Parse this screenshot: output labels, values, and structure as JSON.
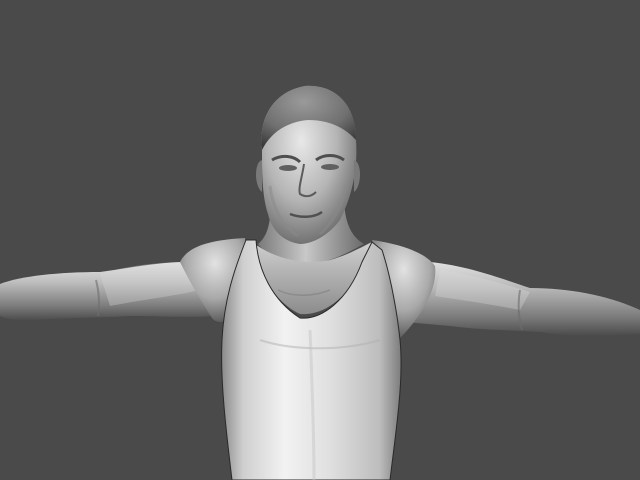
{
  "viewport": {
    "background_color": "#4a4a4a",
    "shading": "grey-clay-matcap",
    "subject": "t-pose-male-character-sculpt",
    "icon": "3d-model-icon"
  },
  "palette": {
    "skin_light": "#dedede",
    "skin_mid": "#a8a8a8",
    "skin_dark": "#555555",
    "shirt_light": "#f2f2f2",
    "shirt_mid": "#cfcfcf",
    "shirt_dark": "#8a8a8a"
  }
}
